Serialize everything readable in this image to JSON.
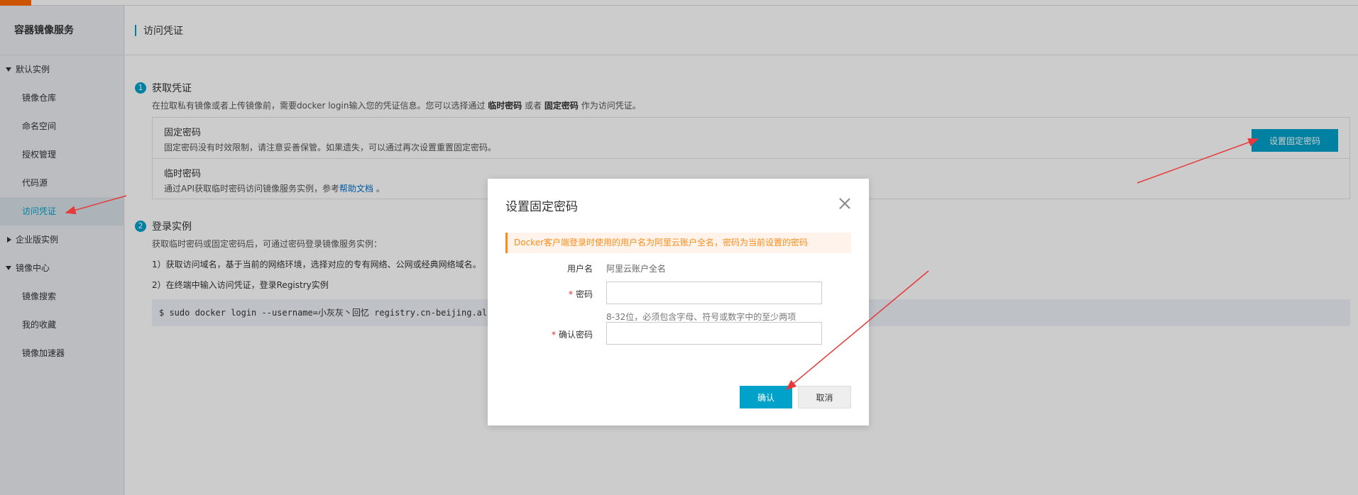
{
  "sidebar": {
    "title": "容器镜像服务",
    "groups": [
      {
        "label": "默认实例",
        "expanded": true,
        "items": [
          "镜像仓库",
          "命名空间",
          "授权管理",
          "代码源",
          "访问凭证"
        ]
      },
      {
        "label": "企业版实例",
        "expanded": false,
        "items": []
      },
      {
        "label": "镜像中心",
        "expanded": true,
        "items": [
          "镜像搜索",
          "我的收藏",
          "镜像加速器"
        ]
      }
    ],
    "active_item": "访问凭证"
  },
  "header": {
    "title": "访问凭证"
  },
  "step1": {
    "num": "1",
    "title": "获取凭证",
    "desc_prefix": "在拉取私有镜像或者上传镜像前，需要docker login输入您的凭证信息。您可以选择通过 ",
    "desc_temp": "临时密码",
    "desc_or": " 或者 ",
    "desc_fixed": "固定密码",
    "desc_suffix": " 作为访问凭证。",
    "fixed": {
      "name": "固定密码",
      "desc": "固定密码没有时效限制，请注意妥善保管。如果遗失，可以通过再次设置重置固定密码。",
      "button": "设置固定密码"
    },
    "temp": {
      "name": "临时密码",
      "desc_prefix": "通过API获取临时密码访问镜像服务实例，参考",
      "link": "帮助文档",
      "desc_suffix": " 。"
    }
  },
  "step2": {
    "num": "2",
    "title": "登录实例",
    "desc": "获取临时密码或固定密码后，可通过密码登录镜像服务实例：",
    "line1": "1）获取访问域名，基于当前的网络环境，选择对应的专有网络、公网或经典网络域名。",
    "line2": "2）在终端中输入访问凭证，登录Registry实例",
    "code": "$ sudo docker login --username=小灰灰丶回忆 registry.cn-beijing.al"
  },
  "modal": {
    "title": "设置固定密码",
    "alert": "Docker客户端登录时使用的用户名为阿里云账户全名，密码为当前设置的密码",
    "username_label": "用户名",
    "username_value": "阿里云账户全名",
    "required_mark": "*",
    "password_label": "密码",
    "password_hint": "8-32位，必须包含字母、符号或数字中的至少两项",
    "confirm_label": "确认密码",
    "confirm_button": "确认",
    "cancel_button": "取消"
  },
  "colors": {
    "accent": "#00a2ca",
    "brand_orange": "#ff6a00",
    "alert_text": "#f98e1a",
    "annotation_arrow": "#e8393a"
  }
}
